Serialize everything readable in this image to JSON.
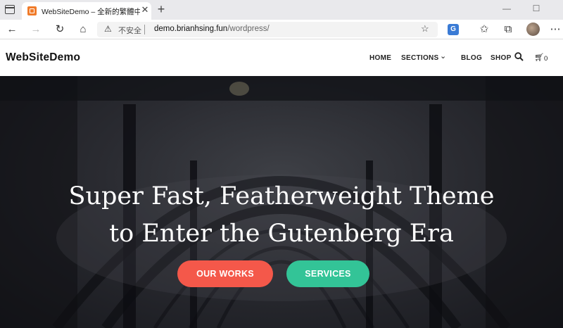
{
  "browser": {
    "tab_title": "WebSiteDemo – 全新的繁體中文",
    "tab_close": "✕",
    "new_tab": "+",
    "security_label": "不安全",
    "url_host": "demo.brianhsing.fun",
    "url_path": "/wordpress/",
    "icons": [
      "tab-actions-icon",
      "back-icon",
      "forward-icon",
      "refresh-icon",
      "home-icon",
      "warning-icon",
      "favorite-icon",
      "translate-icon",
      "favorites-bar-icon",
      "collections-icon",
      "profile-avatar",
      "more-icon"
    ]
  },
  "site": {
    "logo": "WebSiteDemo",
    "nav": [
      "HOME",
      "SECTIONS",
      "BLOG",
      "SHOP"
    ],
    "cart_count": "0"
  },
  "hero": {
    "headline_line1": "Super Fast, Featherweight Theme",
    "headline_line2": "to Enter the Gutenberg Era",
    "button_primary": "OUR WORKS",
    "button_secondary": "SERVICES"
  },
  "colors": {
    "primary_button": "#f4584a",
    "secondary_button": "#33c497",
    "hero_bg": "#2a2b31"
  }
}
